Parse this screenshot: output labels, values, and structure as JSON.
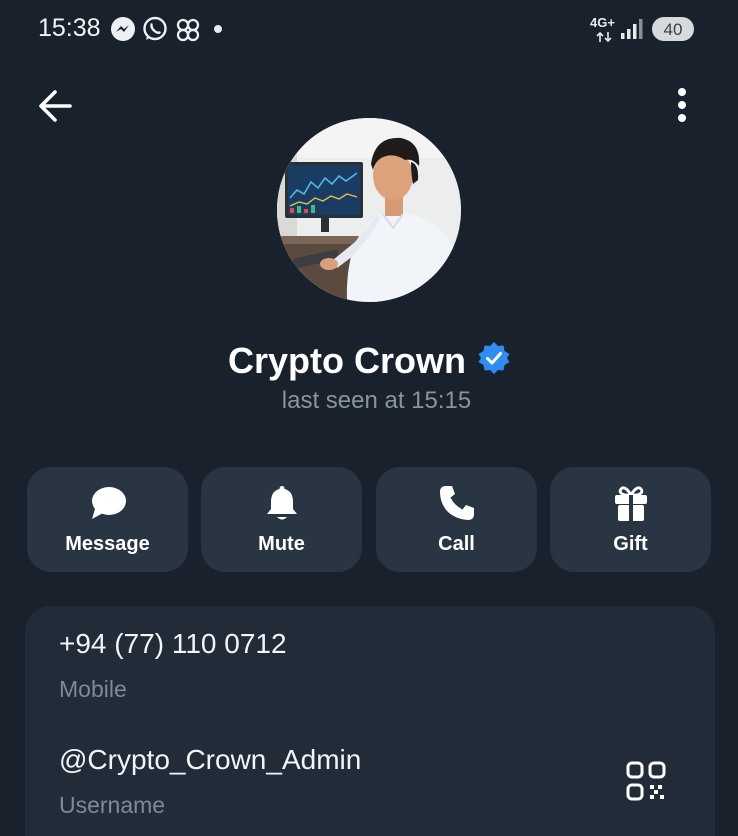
{
  "status_bar": {
    "time": "15:38",
    "notification_icons": [
      "messenger-icon",
      "whatsapp-icon",
      "app-icon"
    ],
    "network": "4G+",
    "battery": "40"
  },
  "top_bar": {
    "back_icon": "arrow-left-icon",
    "more_icon": "more-vertical-icon"
  },
  "profile": {
    "name": "Crypto Crown",
    "verified": true,
    "status": "last seen at 15:15"
  },
  "actions": [
    {
      "label": "Message",
      "icon": "chat-bubble-icon"
    },
    {
      "label": "Mute",
      "icon": "bell-icon"
    },
    {
      "label": "Call",
      "icon": "phone-icon"
    },
    {
      "label": "Gift",
      "icon": "gift-icon"
    }
  ],
  "info": {
    "phone": "+94 (77) 110 0712",
    "phone_label": "Mobile",
    "username": "@Crypto_Crown_Admin",
    "username_label": "Username",
    "qr_icon": "qr-code-icon"
  },
  "colors": {
    "background": "#18212c",
    "button_bg": "#2a3543",
    "card_bg": "#222c38",
    "verified_blue": "#2f8cf0",
    "muted_text": "#8a949f"
  }
}
